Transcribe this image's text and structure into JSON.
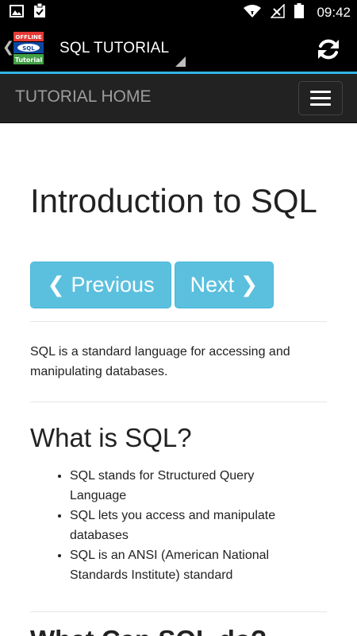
{
  "status_bar": {
    "time": "09:42",
    "left_icons": [
      "image-icon",
      "clipboard-check-icon"
    ],
    "right_icons": [
      "wifi-icon",
      "signal-icon",
      "battery-icon"
    ]
  },
  "action_bar": {
    "title": "SQL TUTORIAL",
    "logo": {
      "line1": "OFFLINE",
      "line2": "SQL",
      "line3": "Tutorial"
    },
    "icons": [
      "up-chevron-icon",
      "refresh-icon"
    ],
    "colors": {
      "background": "#000000",
      "divider": "#33b5e5"
    }
  },
  "navbar": {
    "brand": "TUTORIAL HOME",
    "toggle_icon": "hamburger-menu-icon",
    "colors": {
      "background": "#222222",
      "brand_text": "#9d9d9d"
    }
  },
  "main": {
    "title": "Introduction to SQL",
    "prev_label": "❮ Previous",
    "next_label": "Next ❯",
    "button_color": "#5bc0de",
    "intro": "SQL is a standard language for accessing and manipulating databases.",
    "section1": {
      "heading": "What is SQL?",
      "items": [
        "SQL stands for Structured Query Language",
        "SQL lets you access and manipulate databases",
        "SQL is an ANSI (American National Standards Institute) standard"
      ]
    },
    "section2": {
      "heading": "What Can SQL do?"
    }
  }
}
